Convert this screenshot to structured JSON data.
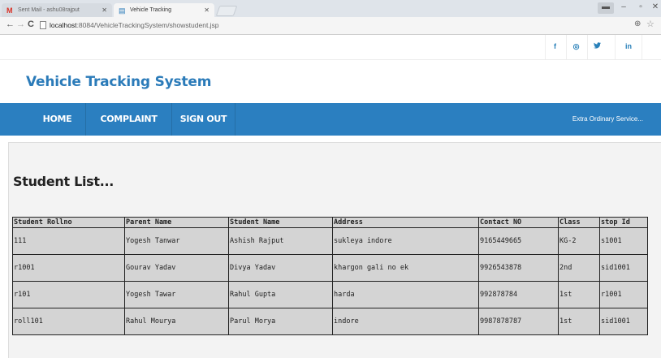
{
  "browser": {
    "tabs": [
      {
        "label": "Sent Mail - ashu08rajput",
        "favicon": "gmail-icon"
      },
      {
        "label": "Vehicle Tracking",
        "favicon": "page-icon"
      }
    ],
    "url_host": "localhost",
    "url_rest": ":8084/VehicleTrackingSystem/showstudent.jsp"
  },
  "social": {
    "facebook": "f",
    "dribbble": "◎",
    "twitter": "🐦",
    "linkedin": "in"
  },
  "site": {
    "title": "Vehicle Tracking System"
  },
  "nav": {
    "items": [
      "HOME",
      "COMPLAINT",
      "SIGN OUT"
    ],
    "tagline": "Extra Ordinary Service..."
  },
  "page": {
    "heading": "Student List..."
  },
  "table": {
    "headers": [
      "Student Rollno",
      "Parent Name",
      "Student Name",
      "Address",
      "Contact NO",
      "Class",
      "stop Id"
    ],
    "rows": [
      [
        "111",
        "Yogesh Tanwar",
        "Ashish Rajput",
        "sukleya indore",
        "9165449665",
        "KG-2",
        "s1001"
      ],
      [
        "r1001",
        "Gourav Yadav",
        "Divya Yadav",
        "khargon gali no ek",
        "9926543878",
        "2nd",
        "sid1001"
      ],
      [
        "r101",
        "Yogesh Tawar",
        "Rahul Gupta",
        "harda",
        "992878784",
        "1st",
        "r1001"
      ],
      [
        "roll101",
        "Rahul Mourya",
        "Parul Morya",
        "indore",
        "9987878787",
        "1st",
        "sid1001"
      ]
    ]
  },
  "colors": {
    "brand": "#2b7bb9",
    "navbar": "#2b7fc0",
    "table_bg": "#d4d4d4"
  }
}
